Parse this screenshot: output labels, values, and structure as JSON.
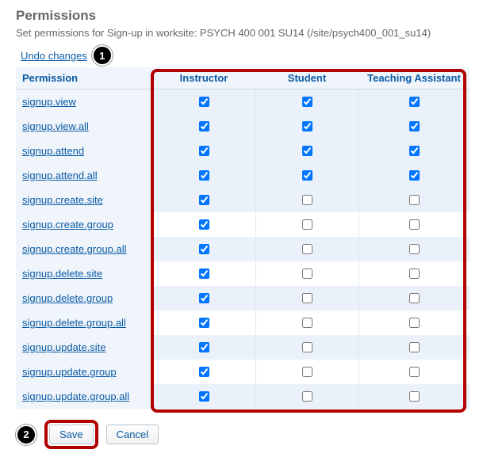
{
  "page": {
    "title": "Permissions",
    "subtitle": "Set permissions for Sign-up in worksite: PSYCH 400 001 SU14 (/site/psych400_001_su14)",
    "undo_label": "Undo changes"
  },
  "callouts": {
    "one": "1",
    "two": "2"
  },
  "table": {
    "header_permission": "Permission",
    "roles": [
      "Instructor",
      "Student",
      "Teaching Assistant"
    ],
    "rows": [
      {
        "perm": "signup.view",
        "vals": [
          true,
          true,
          true
        ]
      },
      {
        "perm": "signup.view.all",
        "vals": [
          true,
          true,
          true
        ]
      },
      {
        "perm": "signup.attend",
        "vals": [
          true,
          true,
          true
        ]
      },
      {
        "perm": "signup.attend.all",
        "vals": [
          true,
          true,
          true
        ]
      },
      {
        "perm": "signup.create.site",
        "vals": [
          true,
          false,
          false
        ]
      },
      {
        "perm": "signup.create.group",
        "vals": [
          true,
          false,
          false
        ]
      },
      {
        "perm": "signup.create.group.all",
        "vals": [
          true,
          false,
          false
        ]
      },
      {
        "perm": "signup.delete.site",
        "vals": [
          true,
          false,
          false
        ]
      },
      {
        "perm": "signup.delete.group",
        "vals": [
          true,
          false,
          false
        ]
      },
      {
        "perm": "signup.delete.group.all",
        "vals": [
          true,
          false,
          false
        ]
      },
      {
        "perm": "signup.update.site",
        "vals": [
          true,
          false,
          false
        ]
      },
      {
        "perm": "signup.update.group",
        "vals": [
          true,
          false,
          false
        ]
      },
      {
        "perm": "signup.update.group.all",
        "vals": [
          true,
          false,
          false
        ]
      }
    ]
  },
  "actions": {
    "save": "Save",
    "cancel": "Cancel"
  }
}
